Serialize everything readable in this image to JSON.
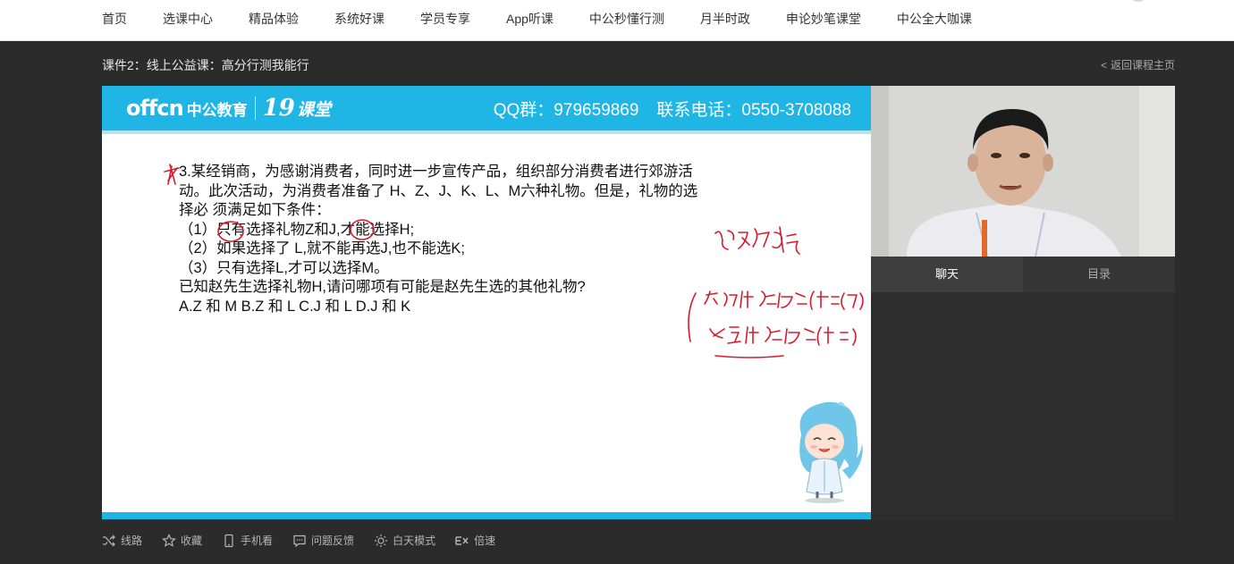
{
  "nav": {
    "items": [
      "首页",
      "选课中心",
      "精品体验",
      "系统好课",
      "学员专享",
      "App听课",
      "中公秒懂行测",
      "月半时政",
      "申论妙笔课堂",
      "中公全大咖课"
    ]
  },
  "course": {
    "title": "课件2：线上公益课：高分行测我能行",
    "back_label": "返回课程主页"
  },
  "video": {
    "logo_en": "offcn",
    "logo_cn": "中公教育",
    "logo_num": "19",
    "logo_kt": "课堂",
    "qq_label": "QQ群：979659869",
    "phone_label": "联系电话：0550-3708088",
    "question_lines": [
      "3.某经销商，为感谢消费者，同时进一步宣传产品，组织部分消费者进行郊游活",
      "动。此次活动，为消费者准备了 H、Z、J、K、L、M六种礼物。但是，礼物的选",
      "择必 须满足如下条件：",
      "（1）只有选择礼物Z和J,才能选择H;",
      "（2）如果选择了 L,就不能再选J,也不能选K;",
      "（3）只有选择L,才可以选择M。",
      "已知赵先生选择礼物H,请问哪项有可能是赵先生选的其他礼物?",
      "A.Z 和 M    B.Z 和 L    C.J 和 L    D.J 和 K"
    ],
    "ink_color": "#d81b2c",
    "brand_color": "#1fb6e6"
  },
  "side": {
    "tabs": [
      "聊天",
      "目录"
    ]
  },
  "toolbar": {
    "route": "线路",
    "favorite": "收藏",
    "mobile": "手机看",
    "feedback": "问题反馈",
    "daymode": "白天模式",
    "speed": "倍速"
  }
}
